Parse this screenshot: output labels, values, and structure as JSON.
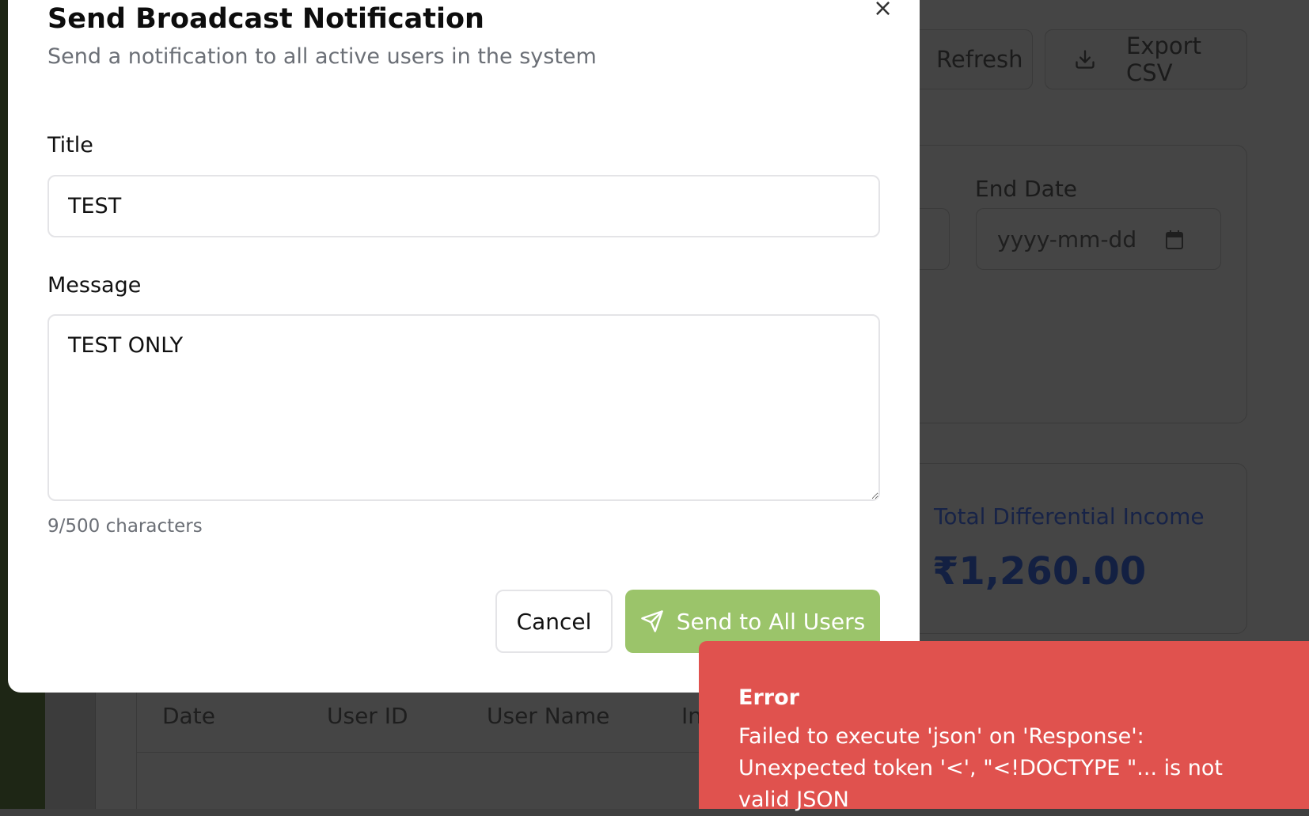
{
  "background": {
    "toolbar": {
      "refresh_label": "Refresh",
      "export_label": "Export CSV"
    },
    "filters": {
      "end_date_label": "End Date",
      "end_date_placeholder": "yyyy-mm-dd"
    },
    "summary": {
      "label": "Total Differential Income",
      "value": "₹1,260.00"
    },
    "table": {
      "headers": [
        "Date",
        "User ID",
        "User Name",
        "In"
      ]
    }
  },
  "modal": {
    "title": "Send Broadcast Notification",
    "subtitle": "Send a notification to all active users in the system",
    "close_label": "×",
    "title_field": {
      "label": "Title",
      "value": "TEST"
    },
    "message_field": {
      "label": "Message",
      "value": "TEST ONLY"
    },
    "char_count": "9/500 characters",
    "cancel_label": "Cancel",
    "send_label": "Send to All Users"
  },
  "toast": {
    "title": "Error",
    "message": "Failed to execute 'json' on 'Response': Unexpected token '<', \"<!DOCTYPE \"... is not valid JSON"
  },
  "colors": {
    "send_button": "#9bc46a",
    "toast_background": "#e0524e",
    "income_text": "#172347"
  }
}
